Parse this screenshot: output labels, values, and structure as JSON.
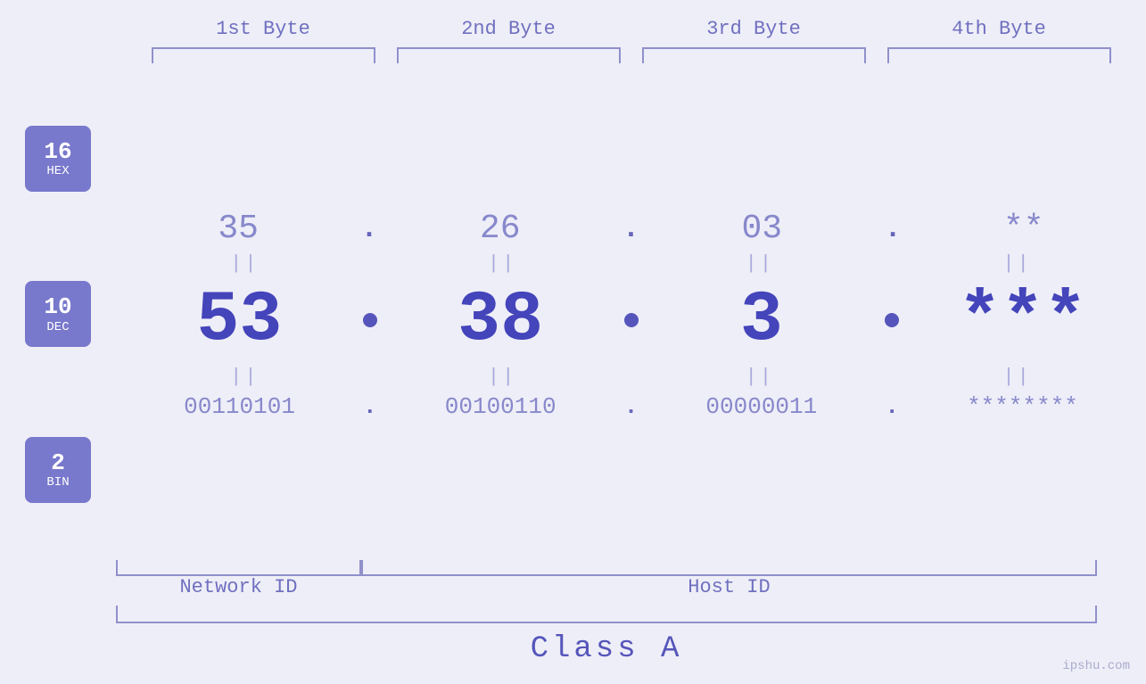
{
  "byteLabels": [
    "1st Byte",
    "2nd Byte",
    "3rd Byte",
    "4th Byte"
  ],
  "badges": [
    {
      "num": "16",
      "label": "HEX"
    },
    {
      "num": "10",
      "label": "DEC"
    },
    {
      "num": "2",
      "label": "BIN"
    }
  ],
  "hex": {
    "values": [
      "35",
      "26",
      "03",
      "**"
    ],
    "dots": [
      ".",
      ".",
      ".",
      ""
    ]
  },
  "dec": {
    "values": [
      "53",
      "38",
      "3",
      "***"
    ],
    "dots": [
      ".",
      ".",
      ".",
      ""
    ]
  },
  "bin": {
    "values": [
      "00110101",
      "00100110",
      "00000011",
      "********"
    ],
    "dots": [
      ".",
      ".",
      ".",
      ""
    ]
  },
  "bottomLabels": {
    "networkId": "Network ID",
    "hostId": "Host ID"
  },
  "classLabel": "Class A",
  "watermark": "ipshu.com"
}
